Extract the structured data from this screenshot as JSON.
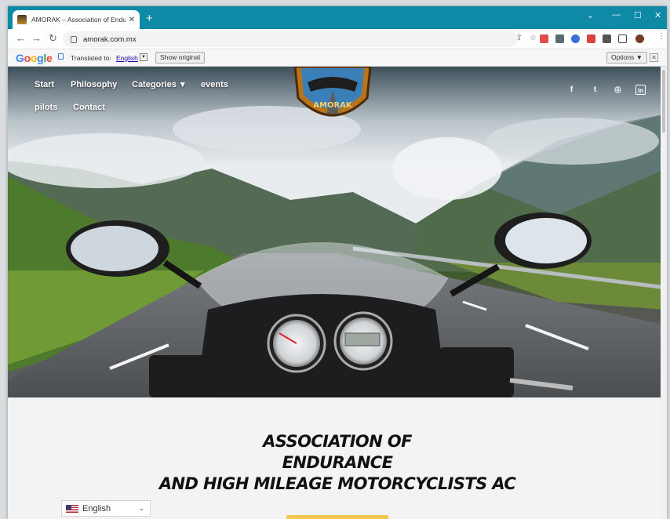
{
  "browser": {
    "tab_title": "AMORAK – Association of Endur...",
    "tab_close": "✕",
    "new_tab": "+",
    "url": "amorak.com.mx"
  },
  "translate_bar": {
    "logo_letters": [
      "G",
      "o",
      "o",
      "g",
      "l",
      "e"
    ],
    "label": "Translated to:",
    "language": "English",
    "show_original": "Show original",
    "options": "Options ▼",
    "close": "✕"
  },
  "site_nav": {
    "items": [
      "Start",
      "Philosophy",
      "Categories",
      "events",
      "pilots",
      "Contact"
    ],
    "categories_chevron": "▾"
  },
  "social": {
    "icons": [
      "facebook-icon",
      "twitter-icon",
      "instagram-icon",
      "linkedin-icon"
    ],
    "glyphs": [
      "f",
      "t",
      "◎",
      "in"
    ]
  },
  "logo": {
    "text": "AMORAK"
  },
  "dashboard": {
    "odometer": "100"
  },
  "content": {
    "heading_lines": [
      "ASSOCIATION OF",
      "ENDURANCE",
      "AND HIGH MILEAGE MOTORCYCLISTS AC"
    ]
  },
  "language_selector": {
    "value": "English",
    "chevron": "⌄"
  },
  "colors": {
    "tab_strip": "#0e8aa7",
    "accent_yellow": "#f2c94c",
    "heading": "#111111"
  }
}
